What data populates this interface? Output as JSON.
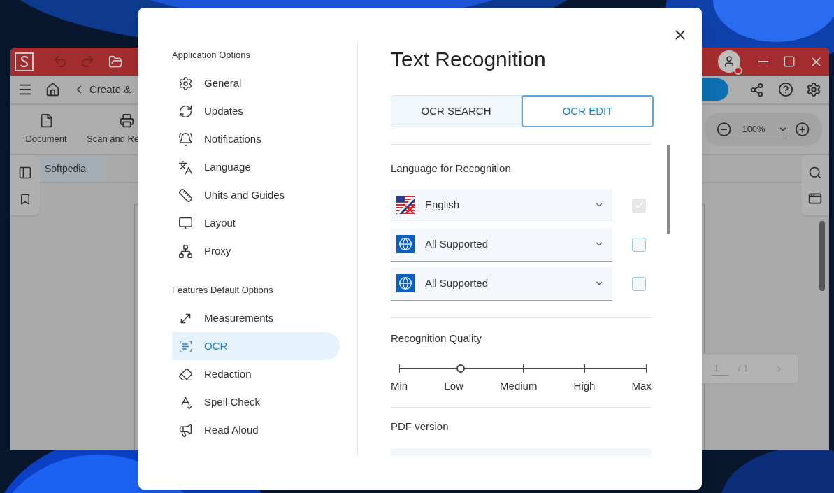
{
  "app": {
    "toolbar_path": "Create &",
    "ribbon": [
      {
        "label": "Document"
      },
      {
        "label": "Scan and Re"
      }
    ],
    "tab": "Softpedia",
    "zoom": "100%",
    "page_nav": {
      "current": "1",
      "total": "/ 1"
    }
  },
  "dialog": {
    "sections": [
      {
        "title": "Application Options",
        "items": [
          {
            "label": "General",
            "selected": false
          },
          {
            "label": "Updates",
            "selected": false
          },
          {
            "label": "Notifications",
            "selected": false
          },
          {
            "label": "Language",
            "selected": false
          },
          {
            "label": "Units and Guides",
            "selected": false
          },
          {
            "label": "Layout",
            "selected": false
          },
          {
            "label": "Proxy",
            "selected": false
          }
        ]
      },
      {
        "title": "Features Default Options",
        "items": [
          {
            "label": "Measurements",
            "selected": false
          },
          {
            "label": "OCR",
            "selected": true
          },
          {
            "label": "Redaction",
            "selected": false
          },
          {
            "label": "Spell Check",
            "selected": false
          },
          {
            "label": "Read Aloud",
            "selected": false
          }
        ]
      }
    ],
    "title": "Text Recognition",
    "tabs": [
      {
        "label": "OCR SEARCH",
        "selected": false
      },
      {
        "label": "OCR EDIT",
        "selected": true
      }
    ],
    "language": {
      "heading": "Language for Recognition",
      "rows": [
        {
          "kind": "flag",
          "value": "English",
          "checked": true,
          "disabled": true
        },
        {
          "kind": "globe",
          "value": "All Supported",
          "checked": false,
          "disabled": false
        },
        {
          "kind": "globe",
          "value": "All Supported",
          "checked": false,
          "disabled": false
        }
      ]
    },
    "quality": {
      "heading": "Recognition Quality",
      "level": 0.25,
      "labels": [
        "Min",
        "Low",
        "Medium",
        "High",
        "Max"
      ]
    },
    "pdf_version": {
      "heading": "PDF version"
    }
  }
}
